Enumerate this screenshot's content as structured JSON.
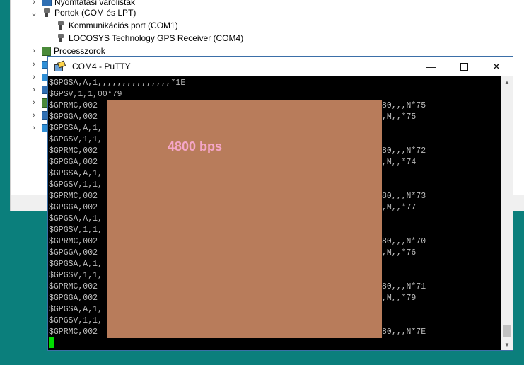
{
  "devmgr": {
    "items": [
      {
        "label": "Nyomtatási várólisták",
        "chevron": "›",
        "icon": "printer-icon"
      },
      {
        "label": "Portok (COM és LPT)",
        "chevron": "⌄",
        "icon": "port-icon"
      },
      {
        "label": "Kommunikációs port (COM1)",
        "icon": "port-icon"
      },
      {
        "label": "LOCOSYS Technology GPS Receiver (COM4)",
        "icon": "port-icon"
      },
      {
        "label": "Processzorok",
        "chevron": "›",
        "icon": "chip-icon"
      }
    ],
    "more_chevrons": [
      "›",
      "›",
      "›",
      "›",
      "›",
      "›"
    ]
  },
  "putty": {
    "title": "COM4 - PuTTY",
    "minimize": "—",
    "close": "✕",
    "scroll_up": "▲",
    "scroll_down": "▼",
    "lines_left": [
      "$GPGSA,A,1,,,,,,,,,,,,,,,*1E",
      "$GPSV,1,1,00*79",
      "$GPRMC,002",
      "$GPGGA,002",
      "$GPGSA,A,1,",
      "$GPGSV,1,1,",
      "$GPRMC,002",
      "$GPGGA,002",
      "$GPGSA,A,1,",
      "$GPGSV,1,1,",
      "$GPRMC,002",
      "$GPGGA,002",
      "$GPGSA,A,1,",
      "$GPGSV,1,1,",
      "$GPRMC,002",
      "$GPGGA,002",
      "$GPGSA,A,1,",
      "$GPGSV,1,1,",
      "$GPRMC,002",
      "$GPGGA,002",
      "$GPGSA,A,1,",
      "$GPGSV,1,1,",
      "$GPRMC,002"
    ],
    "lines_right": [
      "",
      "",
      "80,,,N*75",
      ",M,,*75",
      "",
      "",
      "80,,,N*72",
      ",M,,*74",
      "",
      "",
      "80,,,N*73",
      ",M,,*77",
      "",
      "",
      "80,,,N*70",
      ",M,,*76",
      "",
      "",
      "80,,,N*71",
      ",M,,*79",
      "",
      "",
      "80,,,N*7E"
    ],
    "overlay_label": "4800 bps"
  }
}
